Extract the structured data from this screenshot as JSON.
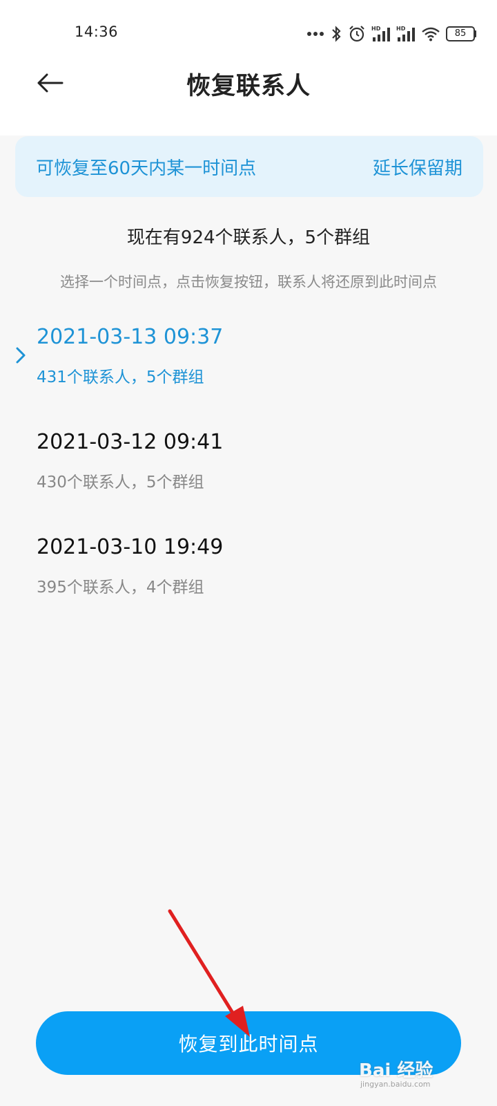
{
  "status_bar": {
    "time": "14:36",
    "battery": "85",
    "icons": [
      "more-dots-icon",
      "bluetooth-icon",
      "alarm-icon",
      "signal-hd-icon",
      "signal-hd-icon",
      "wifi-icon",
      "battery-icon"
    ],
    "hd_label": "HD"
  },
  "header": {
    "title": "恢复联系人",
    "back_icon": "back-arrow-icon"
  },
  "notice": {
    "text": "可恢复至60天内某一时间点",
    "link": "延长保留期"
  },
  "summary": "现在有924个联系人，5个群组",
  "hint": "选择一个时间点，点击恢复按钮，联系人将还原到此时间点",
  "snapshots": [
    {
      "time": "2021-03-13 09:37",
      "detail": "431个联系人，5个群组",
      "selected": true
    },
    {
      "time": "2021-03-12 09:41",
      "detail": "430个联系人，5个群组",
      "selected": false
    },
    {
      "time": "2021-03-10 19:49",
      "detail": "395个联系人，4个群组",
      "selected": false
    }
  ],
  "restore_button": "恢复到此时间点",
  "watermark": {
    "text": "Bai 经验",
    "sub": "jingyan.baidu.com"
  },
  "colors": {
    "accent": "#1e93d6",
    "button": "#0aa0f5",
    "notice_bg": "#e4f3fc",
    "annotation_arrow": "#e02020"
  }
}
